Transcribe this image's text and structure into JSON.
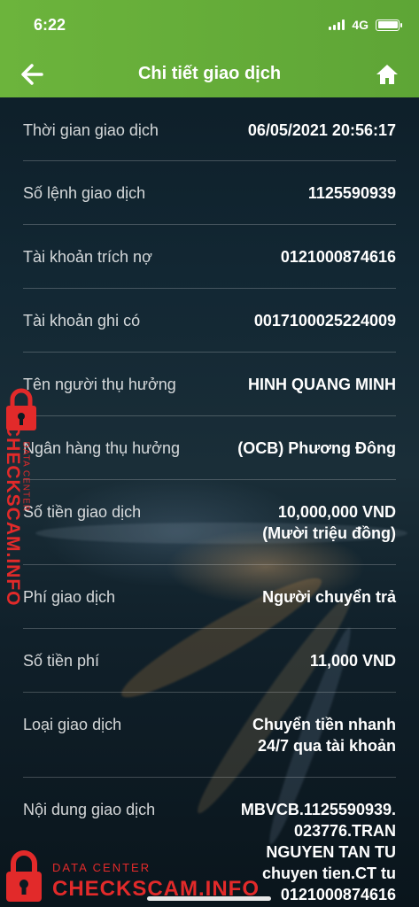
{
  "status_bar": {
    "time": "6:22",
    "network": "4G"
  },
  "header": {
    "title": "Chi tiết giao dịch"
  },
  "rows": [
    {
      "label": "Thời gian giao dịch",
      "value": "06/05/2021 20:56:17"
    },
    {
      "label": "Số lệnh giao dịch",
      "value": "1125590939"
    },
    {
      "label": "Tài khoản trích nợ",
      "value": "0121000874616"
    },
    {
      "label": "Tài khoản ghi có",
      "value": "0017100025224009"
    },
    {
      "label": "Tên người thụ hưởng",
      "value": "HINH QUANG MINH"
    },
    {
      "label": "Ngân hàng thụ hưởng",
      "value": "(OCB) Phương Đông"
    },
    {
      "label": "Số tiền giao dịch",
      "value": "10,000,000 VND",
      "value2": "(Mười triệu đồng)"
    },
    {
      "label": "Phí giao dịch",
      "value": "Người chuyển trả"
    },
    {
      "label": "Số tiền phí",
      "value": "11,000 VND"
    },
    {
      "label": "Loại giao dịch",
      "value": "Chuyển tiền nhanh",
      "value2": "24/7 qua tài khoản"
    },
    {
      "label": "Nội dung giao dịch",
      "value": "MBVCB.1125590939.",
      "value2": "023776.TRAN",
      "value3": "NGUYEN TAN TU",
      "value4": "chuyen tien.CT tu",
      "value5": "0121000874616"
    }
  ],
  "watermark": {
    "small": "DATA CENTER",
    "big": "CHECKSCAM.INFO"
  },
  "colors": {
    "header_green": "#6cb43c",
    "watermark_red": "#e22a2a"
  }
}
